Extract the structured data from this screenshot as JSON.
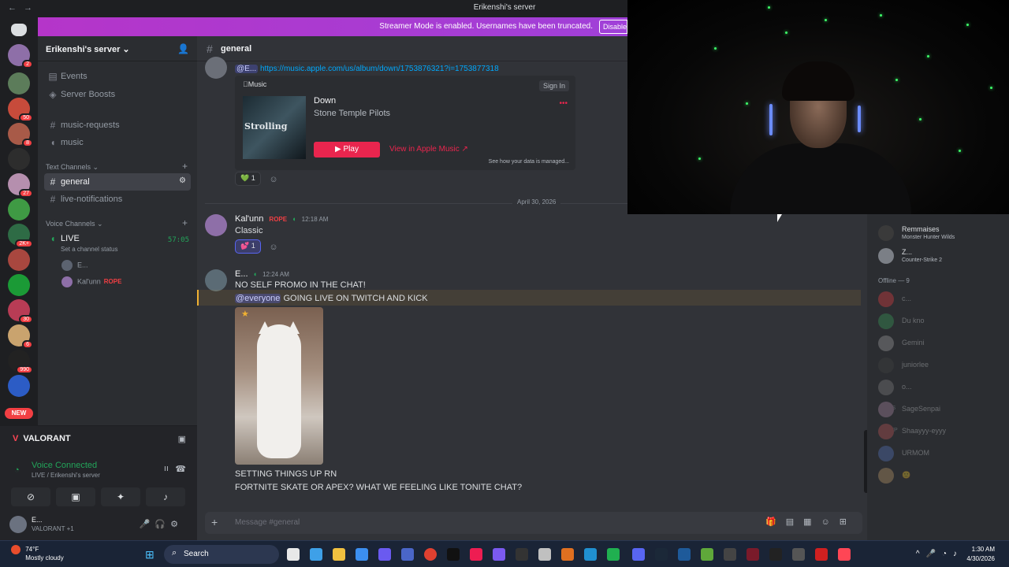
{
  "window": {
    "title": "Erikenshi's server",
    "back": "←",
    "forward": "→"
  },
  "banner": {
    "text": "Streamer Mode is enabled. Usernames have been truncated.",
    "button": "Disable"
  },
  "servers": {
    "badges": [
      "2",
      "50",
      "8",
      "27",
      "2K+",
      "30",
      "6",
      "990"
    ],
    "new_label": "NEW"
  },
  "sidebar": {
    "server_name": "Erikenshi's server ⌄",
    "items": [
      {
        "icon": "calendar-icon",
        "label": "Events"
      },
      {
        "icon": "boost-icon",
        "label": "Server Boosts"
      },
      {
        "icon": "#",
        "label": "music-requests"
      },
      {
        "icon": "speaker-icon",
        "label": "music"
      }
    ],
    "text_category": "Text Channels ⌄",
    "text_channels": [
      {
        "label": "general",
        "active": true
      },
      {
        "label": "live-notifications",
        "active": false
      }
    ],
    "voice_category": "Voice Channels ⌄",
    "voice_channel": {
      "label": "LIVE",
      "timer": "57:05",
      "status_placeholder": "Set a channel status"
    },
    "voice_users": [
      {
        "name": "E...",
        "tag": ""
      },
      {
        "name": "Kal'unn",
        "tag": "ROPE"
      }
    ]
  },
  "voice_panel": {
    "game": "VALORANT",
    "status": "Voice Connected",
    "location": "LIVE / Erikenshi's server",
    "user": {
      "name": "E...",
      "activity": "VALORANT +1"
    }
  },
  "channel": {
    "name": "general"
  },
  "messages": {
    "link_mention": "@E...",
    "link": "https://music.apple.com/us/album/down/1753876321?i=1753877318",
    "embed": {
      "source": "Music",
      "signin": "Sign In",
      "cover_text": "Strolling",
      "song": "Down",
      "artist": "Stone Temple Pilots",
      "play": "Play",
      "view": "View in Apple Music ↗",
      "data_note": "See how your data is managed...",
      "dots": "•••"
    },
    "reaction1": {
      "emoji": "💚",
      "count": "1"
    },
    "date_divider": "April 30, 2026",
    "msg2": {
      "author": "Kal'unn",
      "tag": "ROPE",
      "time": "12:18 AM",
      "text": "Classic",
      "reaction": {
        "emoji": "💕",
        "count": "1"
      }
    },
    "msg3": {
      "author": "E...",
      "time": "12:24 AM",
      "line1": "NO SELF PROMO IN THE CHAT!",
      "mention": "@everyone",
      "line2": " GOING LIVE ON TWITCH AND KICK",
      "line3": "SETTING THINGS UP RN",
      "line4": "FORTNITE SKATE OR APEX? WHAT WE FEELING LIKE TONITE CHAT?"
    }
  },
  "composer": {
    "placeholder": "Message #general"
  },
  "members": {
    "online": [
      {
        "name": "Remmaises",
        "activity": "Monster Hunter Wilds"
      },
      {
        "name": "Z...",
        "activity": "Counter-Strike 2"
      }
    ],
    "offline_header": "Offline — 9",
    "offline": [
      {
        "name": "c...",
        "tag": ""
      },
      {
        "name": "Du kno",
        "tag": ""
      },
      {
        "name": "Gemini",
        "tag": ""
      },
      {
        "name": "juniorlee",
        "tag": ""
      },
      {
        "name": "o...",
        "tag": ""
      },
      {
        "name": "SageSenpai",
        "tag": "RVLS"
      },
      {
        "name": "Shaayyy-eyyy",
        "tag": "RUMP"
      },
      {
        "name": "URMOM",
        "tag": ""
      },
      {
        "name": "🙂",
        "tag": ""
      }
    ]
  },
  "taskbar": {
    "weather_temp": "74°F",
    "weather_desc": "Mostly cloudy",
    "search": "Search",
    "time": "1:30 AM",
    "date": "4/30/2026"
  }
}
